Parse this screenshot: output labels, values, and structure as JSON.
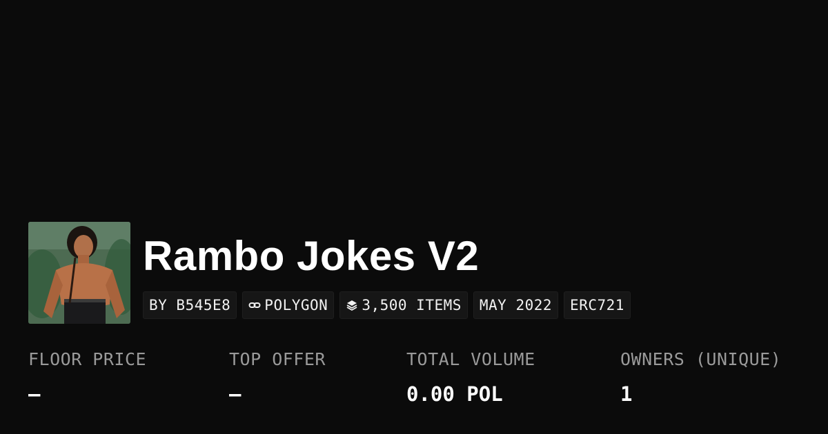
{
  "collection": {
    "name": "Rambo Jokes V2",
    "avatar_alt": "collection-avatar"
  },
  "tags": [
    {
      "label": "BY B545E8",
      "icon": ""
    },
    {
      "label": "POLYGON",
      "icon": "link-icon"
    },
    {
      "label": "3,500 ITEMS",
      "icon": "layers-icon"
    },
    {
      "label": "MAY 2022",
      "icon": ""
    },
    {
      "label": "ERC721",
      "icon": ""
    }
  ],
  "stats": [
    {
      "label": "FLOOR PRICE",
      "value": "—"
    },
    {
      "label": "TOP OFFER",
      "value": "—"
    },
    {
      "label": "TOTAL VOLUME",
      "value": "0.00 POL"
    },
    {
      "label": "OWNERS (UNIQUE)",
      "value": "1"
    }
  ],
  "colors": {
    "background": "#0b0b0b",
    "tag_background": "#161616",
    "label_gray": "#9a9a9a",
    "text": "#ffffff"
  }
}
